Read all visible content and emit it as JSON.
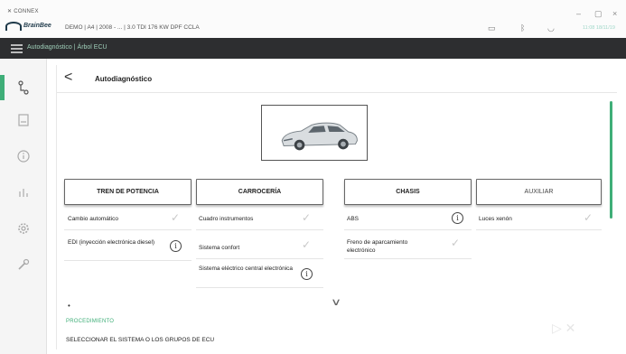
{
  "window": {
    "app_title": "✕ CONNEX",
    "logo_text": "BrainBee",
    "vehicle_info": "DEMO | A4 | 2008 - ... | 3.0 TDI 176 KW DPF CCLA",
    "status_text": "11:08 18/11/19",
    "controls": {
      "minimize": "–",
      "maximize": "▢",
      "close": "×"
    }
  },
  "navbar": {
    "breadcrumb": "Autodiagnóstico | Árbol ECU"
  },
  "sidebar": {
    "items": [
      {
        "icon": "diagnosis-tree-icon"
      },
      {
        "icon": "printer-icon"
      },
      {
        "icon": "info-icon"
      },
      {
        "icon": "chart-icon"
      },
      {
        "icon": "settings-icon"
      },
      {
        "icon": "wrench-icon"
      }
    ]
  },
  "header": {
    "back_label": "<",
    "title": "Autodiagnóstico"
  },
  "groups": [
    {
      "label": "TREN DE POTENCIA"
    },
    {
      "label": "CARROCERÍA"
    },
    {
      "label": "CHASIS"
    },
    {
      "label": "AUXILIAR"
    }
  ],
  "systems": {
    "powertrain": [
      {
        "label": "Cambio automático",
        "status": "check-icon"
      },
      {
        "label": "EDI (inyección electrónica diesel)",
        "status": "info-icon"
      }
    ],
    "body": [
      {
        "label": "Cuadro instrumentos",
        "status": "check-icon"
      },
      {
        "label": "Sistema confort",
        "status": "check-icon"
      },
      {
        "label": "Sistema eléctrico central electrónica",
        "status": "info-icon"
      }
    ],
    "chassis": [
      {
        "label": "ABS",
        "status": "info-icon"
      },
      {
        "label": "Freno de aparcamiento electrónico",
        "status": "check-icon"
      }
    ],
    "auxiliary": [
      {
        "label": "Luces xenón",
        "status": "check-icon"
      }
    ]
  },
  "procedure": {
    "label": "PROCEDIMIENTO",
    "text": "SELECCIONAR EL SISTEMA O LOS GRUPOS DE ECU"
  },
  "colors": {
    "accent": "#3fae78",
    "navbar": "#2d2e30"
  }
}
